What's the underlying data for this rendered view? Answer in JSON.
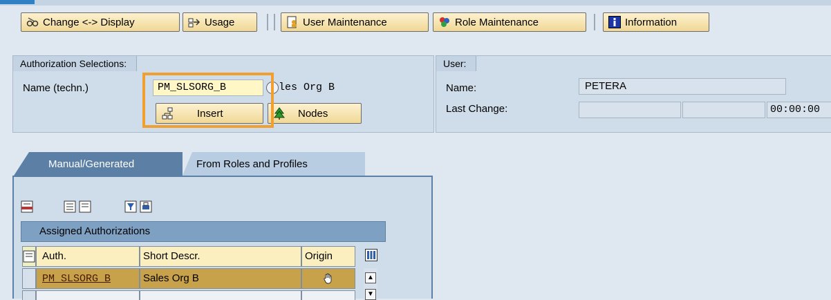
{
  "toolbar": {
    "change_display": "Change <-> Display",
    "usage": "Usage",
    "user_maintenance": "User Maintenance",
    "role_maintenance": "Role Maintenance",
    "information": "Information"
  },
  "auth_selection": {
    "title": "Authorization Selections:",
    "name_label": "Name (techn.)",
    "name_value": "PM_SLSORG_B",
    "name_desc": "les Org B",
    "insert_label": "Insert",
    "nodes_label": "Nodes"
  },
  "user_box": {
    "title": "User:",
    "name_label": "Name:",
    "name_value": "PETERA",
    "last_change_label": "Last Change:",
    "last_change_time": "00:00:00"
  },
  "tabs": [
    {
      "label": "Manual/Generated",
      "active": true
    },
    {
      "label": "From Roles and Profiles",
      "active": false
    }
  ],
  "table": {
    "title": "Assigned Authorizations",
    "columns": [
      "Auth.",
      "Short Descr.",
      "Origin"
    ],
    "rows": [
      {
        "auth": "PM_SLSORG_B",
        "descr": "Sales Org B"
      }
    ]
  },
  "colors": {
    "highlight": "#f0a030",
    "selected_row": "#c8a24a"
  }
}
